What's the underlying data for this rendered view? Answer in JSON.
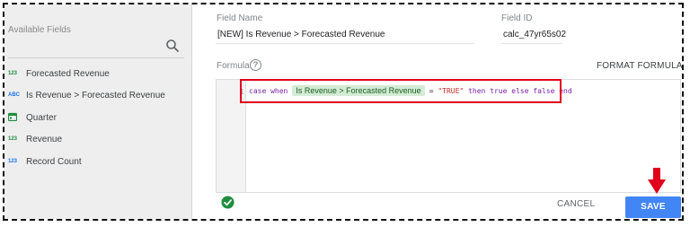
{
  "available_fields": {
    "label": "Available Fields",
    "items": [
      {
        "type_icon": "123",
        "label": "Forecasted Revenue"
      },
      {
        "type_icon": "ABC",
        "label": "Is Revenue > Forecasted Revenue"
      },
      {
        "type_icon": "calendar-icon",
        "label": "Quarter"
      },
      {
        "type_icon": "123",
        "label": "Revenue"
      },
      {
        "type_icon": "123",
        "label": "Record Count"
      }
    ]
  },
  "field_name": {
    "label": "Field Name",
    "value": "[NEW] Is Revenue > Forecasted Revenue"
  },
  "field_id": {
    "label": "Field ID",
    "value": "calc_47yr65s02"
  },
  "formula": {
    "label": "Formula",
    "help_icon": "?",
    "format_label": "FORMAT FORMULA",
    "line_number": "1",
    "tokens": {
      "kw1": "case when",
      "chip": "Is Revenue > Forecasted Revenue",
      "op": "=",
      "str": "\"TRUE\"",
      "kw2": "then true else false end"
    }
  },
  "footer": {
    "status_icon": "check-circle-icon",
    "cancel_label": "CANCEL",
    "save_label": "SAVE"
  },
  "colors": {
    "annotation_red": "#e0001b",
    "save_button": "#4285f4",
    "chip_bg": "#d4ecd5",
    "check_green": "#1e8e3e"
  }
}
